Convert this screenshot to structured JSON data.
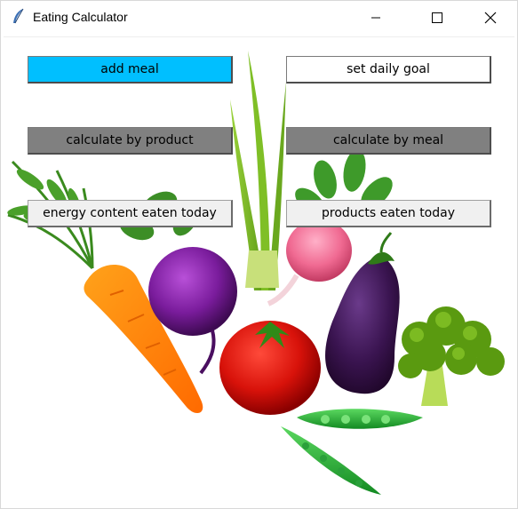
{
  "window": {
    "title": "Eating Calculator",
    "icon": "feather-icon"
  },
  "buttons": {
    "add_meal": "add meal",
    "set_daily_goal": "set daily goal",
    "calculate_by_product": "calculate by product",
    "calculate_by_meal": "calculate by meal",
    "energy_content": "energy content eaten today",
    "products_eaten": "products eaten today"
  },
  "colors": {
    "add_meal_bg": "#00bfff",
    "goal_bg": "#ffffff",
    "calc_bg": "#808080",
    "list_bg": "#f0f0f0"
  },
  "background_image": "vegetables-illustration"
}
